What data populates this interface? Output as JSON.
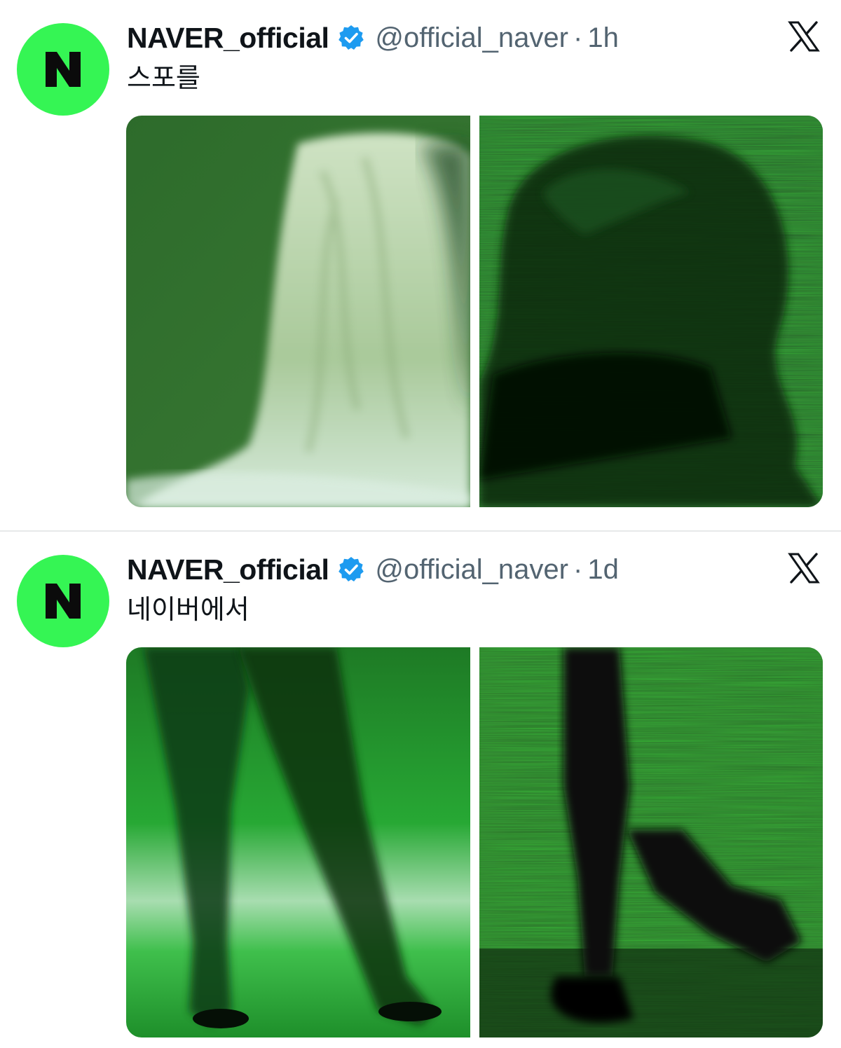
{
  "tweets": [
    {
      "display_name": "NAVER_official",
      "handle": "@official_naver",
      "separator": "·",
      "time": "1h",
      "text": "스포를",
      "avatar_letter": "N",
      "icons": {
        "verified": "verified-badge-icon",
        "platform": "x-logo-icon"
      },
      "media": [
        {
          "name": "media-photo-blonde-hair",
          "style": "photo"
        },
        {
          "name": "media-photo-glitch-silhouette",
          "style": "glitch"
        }
      ]
    },
    {
      "display_name": "NAVER_official",
      "handle": "@official_naver",
      "separator": "·",
      "time": "1d",
      "text": "네이버에서",
      "avatar_letter": "N",
      "icons": {
        "verified": "verified-badge-icon",
        "platform": "x-logo-icon"
      },
      "media": [
        {
          "name": "media-photo-legs-walking",
          "style": "photo"
        },
        {
          "name": "media-photo-glitch-legs",
          "style": "glitch"
        }
      ]
    }
  ],
  "colors": {
    "avatar_bg": "#35f554",
    "verified_blue": "#1d9bf0",
    "secondary_text": "#536471",
    "divider": "#e7e9ea"
  }
}
